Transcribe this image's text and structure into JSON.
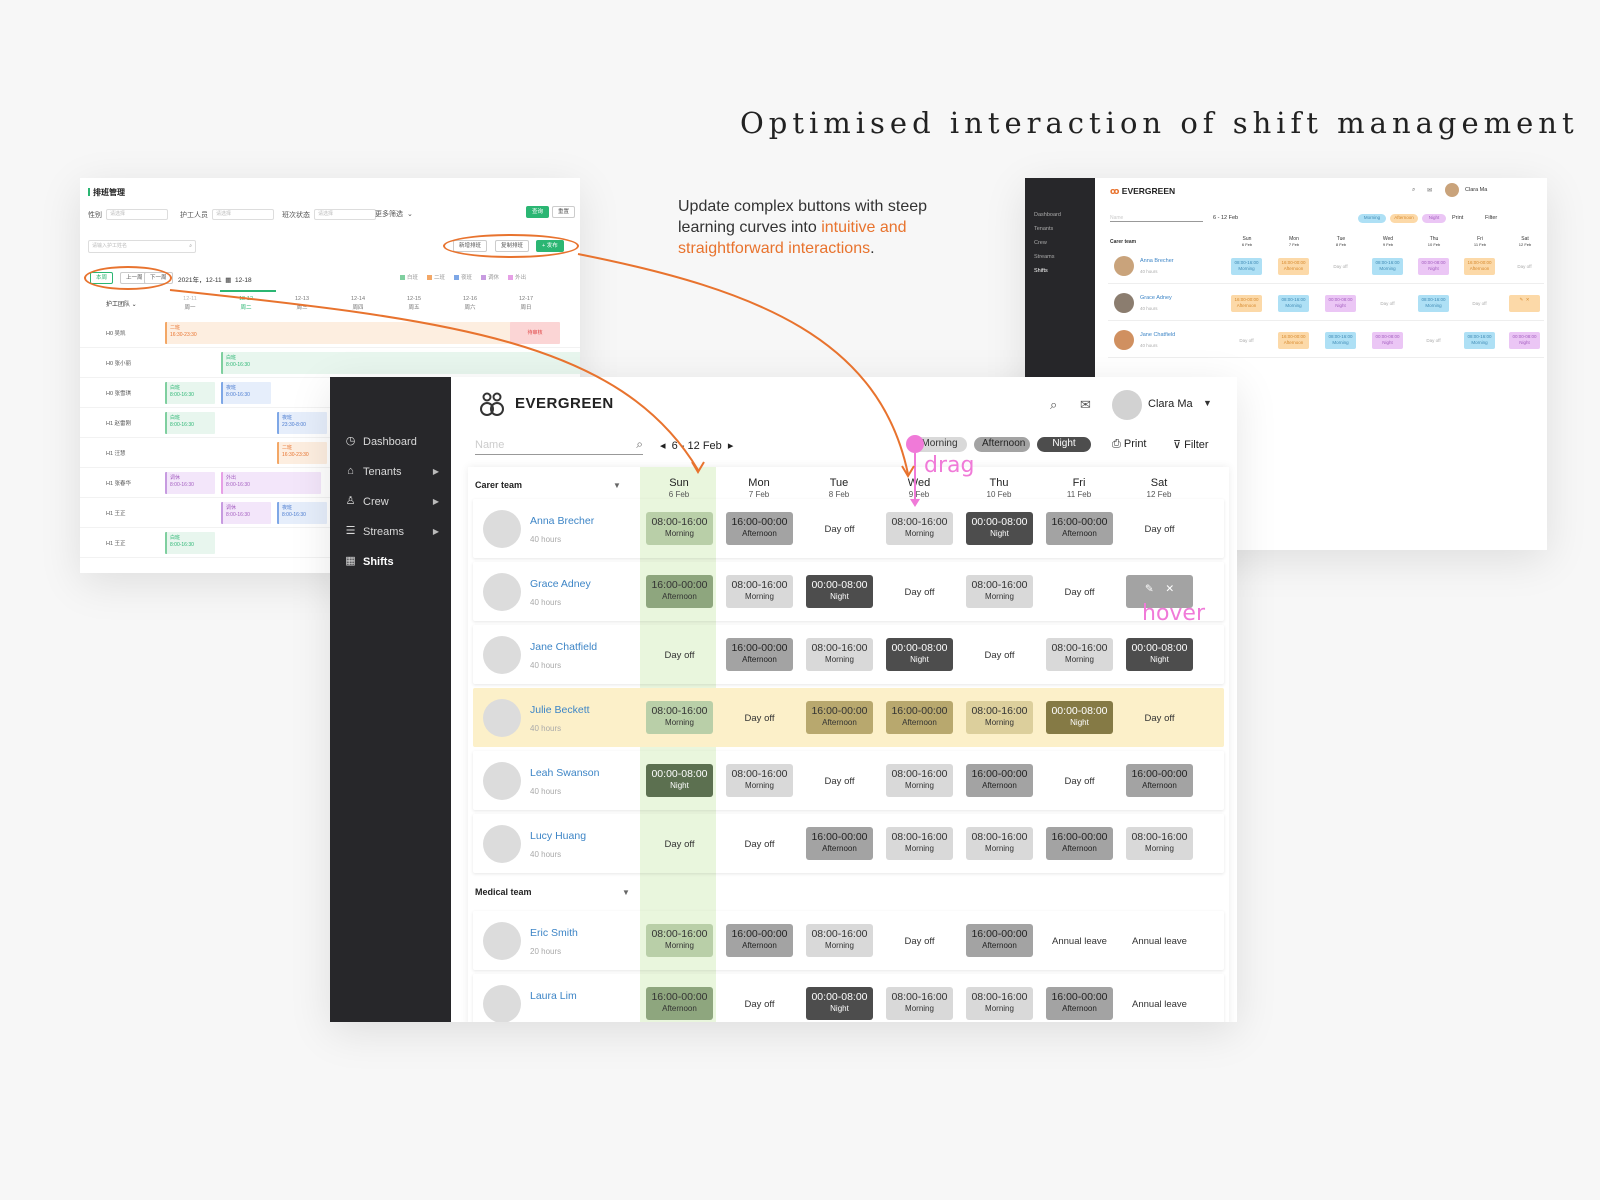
{
  "headline": "Optimised interaction of shift management",
  "blurb": {
    "part1": "Update complex buttons with steep learning curves into ",
    "highlight": "intuitive and straightforward interactions",
    "part2": "."
  },
  "old_ui": {
    "title": "排班管理",
    "filters": [
      {
        "label": "性别",
        "placeholder": "请选择"
      },
      {
        "label": "护工人员",
        "placeholder": "请选择"
      },
      {
        "label": "班次状态",
        "placeholder": "请选择"
      }
    ],
    "more": "更多筛选",
    "query_btn": "查询",
    "reset_btn": "重置",
    "search_placeholder": "请输入护工姓名",
    "btn_new": "新增排班",
    "btn_copy": "复制排班",
    "btn_publish": "+ 发布",
    "week_btns": [
      "本周",
      "上一周",
      "下一周"
    ],
    "date_range": "2021年，12-11",
    "date_end": "12-18",
    "legend": [
      "白班",
      "二班",
      "夜班",
      "调休",
      "外出"
    ],
    "team_header": "护工团队",
    "days": [
      {
        "date": "12-11",
        "wd": "周一"
      },
      {
        "date": "12-12",
        "wd": "周二"
      },
      {
        "date": "12-13",
        "wd": "周三"
      },
      {
        "date": "12-14",
        "wd": "周四"
      },
      {
        "date": "12-15",
        "wd": "周五"
      },
      {
        "date": "12-16",
        "wd": "周六"
      },
      {
        "date": "12-17",
        "wd": "周日"
      }
    ],
    "rows": [
      "H0 吴凯",
      "H0 张小丽",
      "H0 张雪琪",
      "H1 赵雷刚",
      "H1 汪慧",
      "H1 张春华",
      "H1 王正",
      "H1 王正"
    ],
    "cell_labels": {
      "bar": "二班",
      "bar_time": "16:30-23:30",
      "pending": "待审核",
      "white": "白班",
      "white_time": "8:00-16:30",
      "night": "夜班",
      "night_time": "23:30-8:00",
      "rest": "调休",
      "out": "外出"
    }
  },
  "mini_ui": {
    "brand": "EVERGREEN",
    "user": "Clara Ma",
    "nav": [
      "Dashboard",
      "Tenants",
      "Crew",
      "Streams",
      "Shifts"
    ],
    "week": "6 - 12 Feb",
    "chips": [
      "Morning",
      "Afternoon",
      "Night"
    ],
    "print": "Print",
    "filter": "Filter",
    "team": "Carer team",
    "search": "Name",
    "days": [
      "Sun",
      "Mon",
      "Tue",
      "Wed",
      "Thu",
      "Fri",
      "Sat"
    ],
    "dates": [
      "6 Feb",
      "7 Feb",
      "8 Feb",
      "9 Feb",
      "10 Feb",
      "11 Feb",
      "12 Feb"
    ],
    "people": [
      "Anna Brecher",
      "Grace Adney",
      "Jane Chatfield"
    ],
    "hours": "40 hours"
  },
  "app": {
    "brand": "EVERGREEN",
    "user": "Clara Ma",
    "nav": [
      {
        "label": "Dashboard",
        "icon": "dashboard-icon",
        "glyph": "◷"
      },
      {
        "label": "Tenants",
        "icon": "tenants-icon",
        "glyph": "⌂"
      },
      {
        "label": "Crew",
        "icon": "crew-icon",
        "glyph": "♙"
      },
      {
        "label": "Streams",
        "icon": "streams-icon",
        "glyph": "☰"
      },
      {
        "label": "Shifts",
        "icon": "calendar-icon",
        "glyph": "▦"
      }
    ],
    "search_placeholder": "Name",
    "week_label": "6 - 12 Feb",
    "chips": {
      "morning": "Morning",
      "afternoon": "Afternoon",
      "night": "Night"
    },
    "print": "Print",
    "filter": "Filter",
    "days": [
      {
        "day": "Sun",
        "date": "6 Feb"
      },
      {
        "day": "Mon",
        "date": "7 Feb"
      },
      {
        "day": "Tue",
        "date": "8 Feb"
      },
      {
        "day": "Wed",
        "date": "9 Feb"
      },
      {
        "day": "Thu",
        "date": "10 Feb"
      },
      {
        "day": "Fri",
        "date": "11 Feb"
      },
      {
        "day": "Sat",
        "date": "12 Feb"
      }
    ],
    "teams": [
      {
        "name": "Carer team",
        "people": [
          {
            "name": "Anna Brecher",
            "hours": "40 hours",
            "shifts": [
              "M",
              "A",
              "O",
              "M",
              "N",
              "A",
              "O"
            ]
          },
          {
            "name": "Grace Adney",
            "hours": "40 hours",
            "shifts": [
              "A",
              "M",
              "N",
              "O",
              "M",
              "O",
              "H"
            ]
          },
          {
            "name": "Jane Chatfield",
            "hours": "40 hours",
            "shifts": [
              "O",
              "A",
              "M",
              "N",
              "O",
              "M",
              "N"
            ]
          },
          {
            "name": "Julie Beckett",
            "hours": "40 hours",
            "shifts": [
              "M",
              "O",
              "A",
              "A",
              "M",
              "N",
              "O"
            ],
            "highlight": true
          },
          {
            "name": "Leah Swanson",
            "hours": "40 hours",
            "shifts": [
              "N",
              "M",
              "O",
              "M",
              "A",
              "O",
              "A"
            ]
          },
          {
            "name": "Lucy Huang",
            "hours": "40 hours",
            "shifts": [
              "O",
              "O",
              "A",
              "M",
              "M",
              "A",
              "M"
            ]
          }
        ]
      },
      {
        "name": "Medical team",
        "people": [
          {
            "name": "Eric Smith",
            "hours": "20 hours",
            "shifts": [
              "M",
              "A",
              "M",
              "O",
              "A",
              "L",
              "L"
            ]
          },
          {
            "name": "Laura Lim",
            "hours": "",
            "shifts": [
              "A",
              "O",
              "N",
              "M",
              "M",
              "A",
              "L"
            ]
          }
        ]
      }
    ],
    "shift_types": {
      "M": {
        "time": "08:00-16:00",
        "label": "Morning"
      },
      "A": {
        "time": "16:00-00:00",
        "label": "Afternoon"
      },
      "N": {
        "time": "00:00-08:00",
        "label": "Night"
      },
      "O": {
        "time": "Day off",
        "label": ""
      },
      "L": {
        "time": "Annual leave",
        "label": ""
      }
    }
  },
  "annotations": {
    "drag": "drag",
    "hover": "hover"
  },
  "colors": {
    "accent": "#e8732e",
    "annotation": "#f07ad8",
    "green": "#2bb673",
    "sidebar": "#27272a"
  }
}
